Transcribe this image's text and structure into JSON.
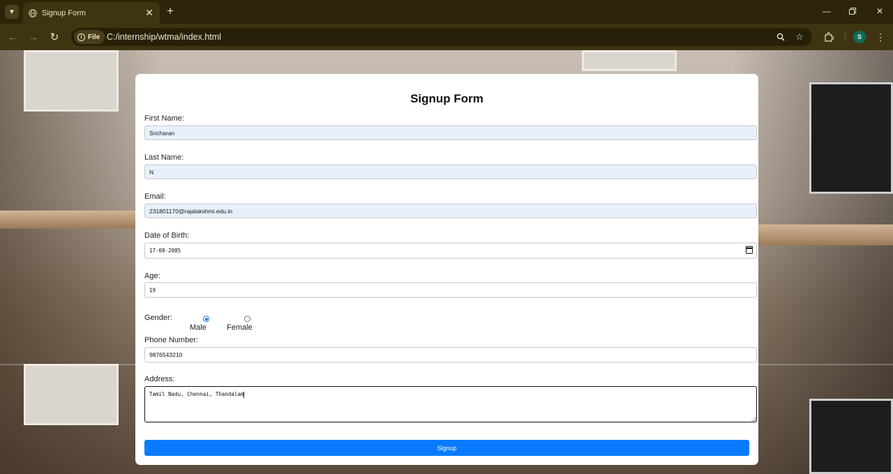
{
  "browser": {
    "tab_title": "Signup Form",
    "address_chip": "File",
    "url": "C:/internship/wtma/index.html",
    "profile_initial": "S"
  },
  "icons": {
    "tab_search": "chevron-down-icon",
    "favicon": "globe-icon",
    "tab_close": "close-icon",
    "new_tab": "plus-icon",
    "minimize": "minimize-icon",
    "maximize": "restore-icon",
    "window_close": "close-icon",
    "back": "arrow-left-icon",
    "forward": "arrow-right-icon",
    "reload": "reload-icon",
    "site_info": "info-icon",
    "zoom": "zoom-icon",
    "bookmark": "star-icon",
    "extensions": "puzzle-icon",
    "menu": "kebab-menu-icon",
    "calendar": "calendar-icon"
  },
  "colors": {
    "chrome_bg": "#2d2509",
    "toolbar_bg": "#3e3412",
    "autofill_bg": "#e8f0fe",
    "submit_bg": "#0a7bff",
    "avatar_bg": "#116a55"
  },
  "form": {
    "title": "Signup Form",
    "first_name": {
      "label": "First Name:",
      "value": "Sricharan"
    },
    "last_name": {
      "label": "Last Name:",
      "value": "N"
    },
    "email": {
      "label": "Email:",
      "value": "231801170@rajalakshmi.edu.in"
    },
    "dob": {
      "label": "Date of Birth:",
      "value": "17-08-2005"
    },
    "age": {
      "label": "Age:",
      "value": "19"
    },
    "gender": {
      "label": "Gender:",
      "options": [
        {
          "label": "Male",
          "checked": true
        },
        {
          "label": "Female",
          "checked": false
        }
      ]
    },
    "phone": {
      "label": "Phone Number:",
      "value": "9876543210"
    },
    "address": {
      "label": "Address:",
      "value": "Tamil Nadu, Chennai, Thandalam"
    },
    "submit_label": "Signup"
  }
}
